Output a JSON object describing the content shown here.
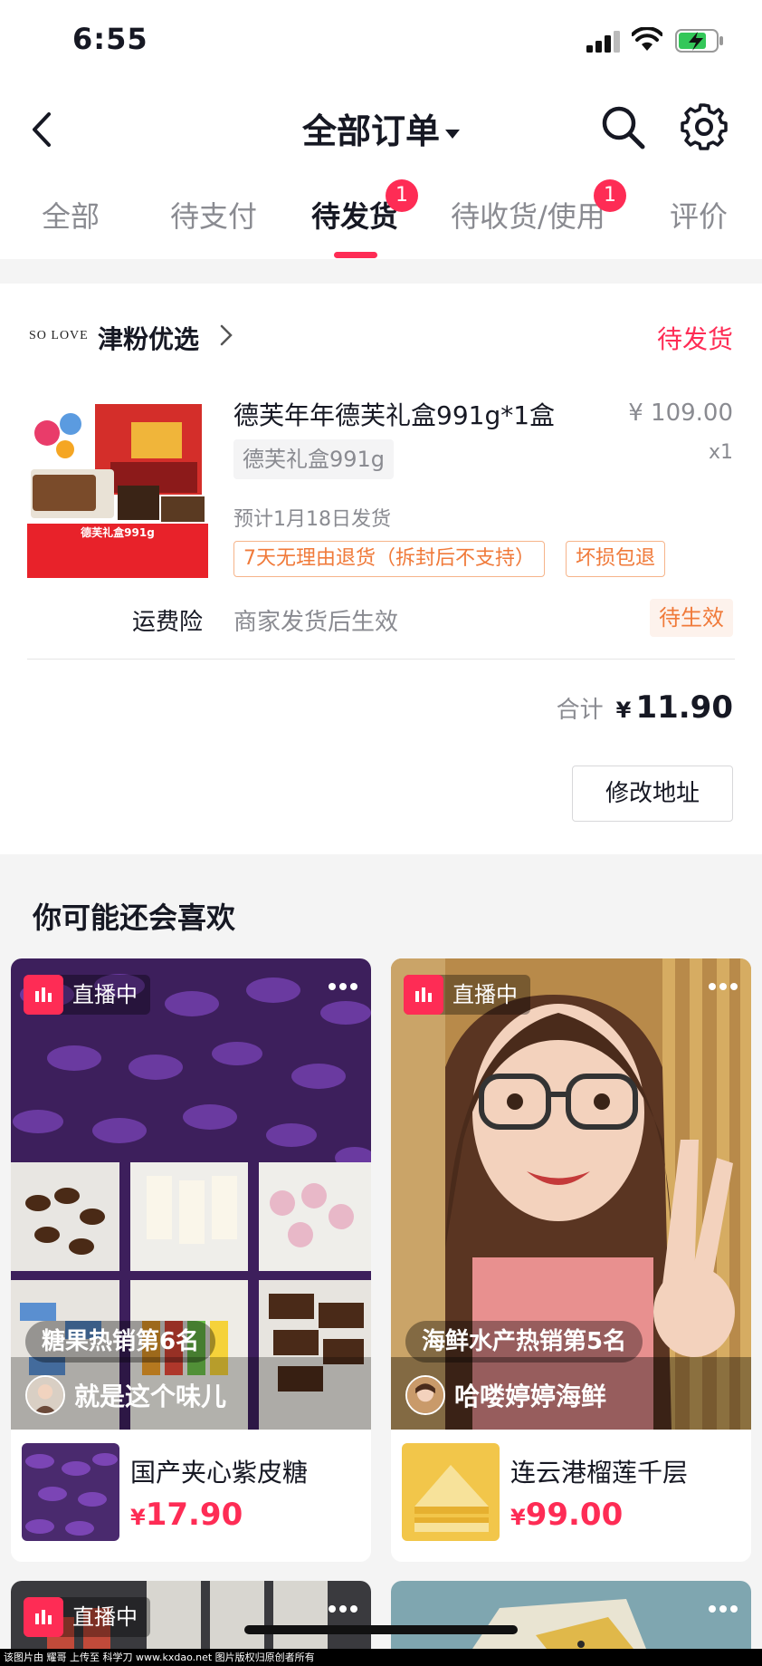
{
  "status_bar": {
    "time": "6:55"
  },
  "nav": {
    "title": "全部订单"
  },
  "tabs": [
    {
      "label": "全部"
    },
    {
      "label": "待支付"
    },
    {
      "label": "待发货",
      "badge": "1"
    },
    {
      "label": "待收货/使用",
      "badge": "1"
    },
    {
      "label": "评价"
    }
  ],
  "order": {
    "shop_logo_text": "SO LOVE",
    "shop_name": "津粉优选",
    "status": "待发货",
    "product": {
      "title": "德芙年年德芙礼盒991g*1盒",
      "price": "¥ 109.00",
      "quantity": "x1",
      "spec": "德芙礼盒991g",
      "ship_estimate": "预计1月18日发货",
      "tags": [
        "7天无理由退货（拆封后不支持）",
        "坏损包退"
      ],
      "thumb_title": "德芙礼盒991g"
    },
    "insurance": {
      "label": "运费险",
      "desc": "商家发货后生效",
      "badge": "待生效"
    },
    "total": {
      "label": "合计",
      "currency": "¥",
      "value": "11.90"
    },
    "modify_button": "修改地址"
  },
  "recommend": {
    "title": "你可能还会喜欢",
    "cards": [
      {
        "live_label": "直播中",
        "rank": "糖果热销第6名",
        "host": "就是这个味儿",
        "goods_name": "国产夹心紫皮糖",
        "price_currency": "¥",
        "price": "17.90"
      },
      {
        "live_label": "直播中",
        "rank": "海鲜水产热销第5名",
        "host": "哈喽婷婷海鲜",
        "goods_name": "连云港榴莲千层",
        "price_currency": "¥",
        "price": "99.00"
      },
      {
        "live_label": "直播中"
      }
    ]
  },
  "watermark": "该图片由 耀哥 上传至 科学刀 www.kxdao.net 图片版权归原创者所有",
  "colors": {
    "accent": "#fe2c55",
    "tag_orange": "#f07a3a"
  }
}
